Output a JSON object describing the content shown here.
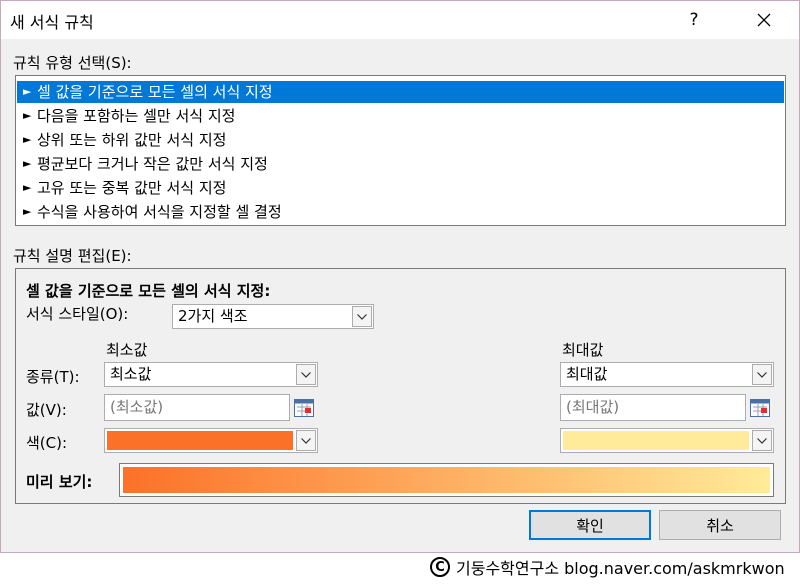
{
  "window": {
    "title": "새 서식 규칙",
    "help_label": "?"
  },
  "rule_type": {
    "label": "규칙 유형 선택(S):",
    "items": [
      {
        "label": "셀 값을 기준으로 모든 셀의 서식 지정",
        "selected": true
      },
      {
        "label": "다음을 포함하는 셀만 서식 지정",
        "selected": false
      },
      {
        "label": "상위 또는 하위 값만 서식 지정",
        "selected": false
      },
      {
        "label": "평균보다 크거나 작은 값만 서식 지정",
        "selected": false
      },
      {
        "label": "고유 또는 중복 값만 서식 지정",
        "selected": false
      },
      {
        "label": "수식을 사용하여 서식을 지정할 셀 결정",
        "selected": false
      }
    ]
  },
  "description": {
    "label": "규칙 설명 편집(E):",
    "heading": "셀 값을 기준으로 모든 셀의 서식 지정:",
    "format_style_label": "서식 스타일(O):",
    "format_style_value": "2가지 색조",
    "min_header": "최소값",
    "max_header": "최대값",
    "type_label": "종류(T):",
    "value_label": "값(V):",
    "color_label": "색(C):",
    "min_type": "최소값",
    "max_type": "최대값",
    "min_value_placeholder": "(최소값)",
    "max_value_placeholder": "(최대값)",
    "min_color": "#fc7128",
    "max_color": "#ffeb99",
    "preview_label": "미리 보기:"
  },
  "buttons": {
    "ok": "확인",
    "cancel": "취소"
  },
  "credit": {
    "symbol": "C",
    "text": "기둥수학연구소 blog.naver.com/askmrkwon"
  },
  "colors": {
    "selection": "#0078d7",
    "dialog_bg": "#f0f0f0"
  }
}
